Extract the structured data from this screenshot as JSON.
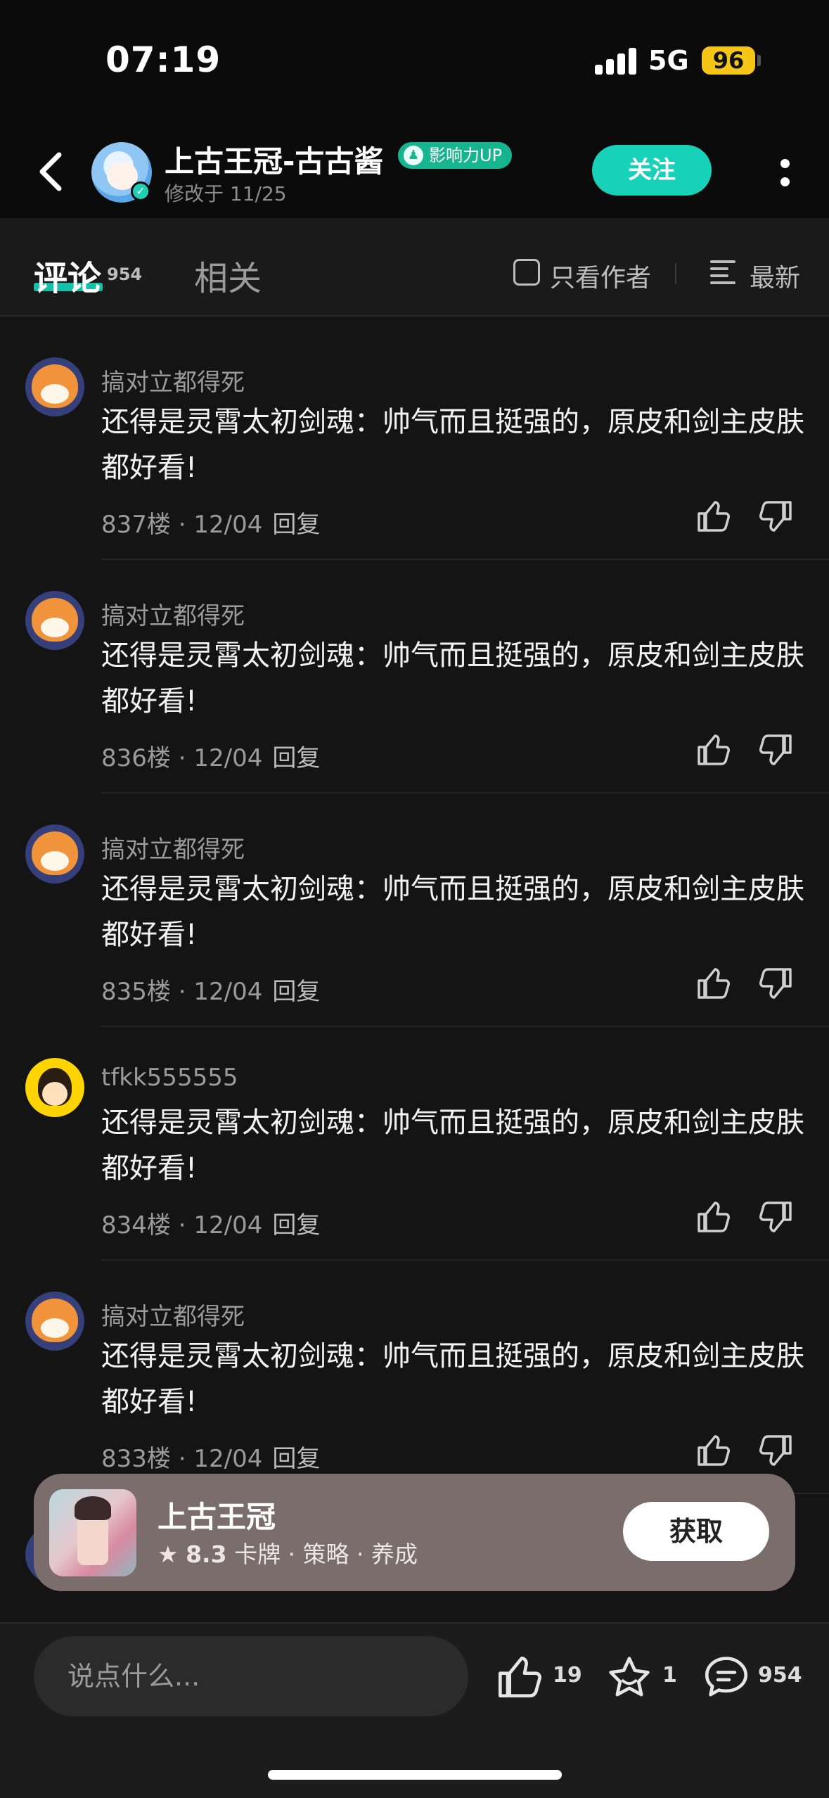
{
  "status_bar": {
    "time": "07:19",
    "network": "5G",
    "battery": "96"
  },
  "header": {
    "title": "上古王冠-古古酱",
    "badge": "影响力UP",
    "subtitle": "修改于 11/25",
    "follow_label": "关注"
  },
  "tabs": {
    "comments_label": "评论",
    "comments_count": "954",
    "related_label": "相关",
    "only_author_label": "只看作者",
    "sort_label": "最新"
  },
  "comments": [
    {
      "user": "搞对立都得死",
      "text": "还得是灵霄太初剑魂：帅气而且挺强的，原皮和剑主皮肤都好看!",
      "floor": "837楼",
      "date": "12/04",
      "reply": "回复"
    },
    {
      "user": "搞对立都得死",
      "text": "还得是灵霄太初剑魂：帅气而且挺强的，原皮和剑主皮肤都好看!",
      "floor": "836楼",
      "date": "12/04",
      "reply": "回复"
    },
    {
      "user": "搞对立都得死",
      "text": "还得是灵霄太初剑魂：帅气而且挺强的，原皮和剑主皮肤都好看!",
      "floor": "835楼",
      "date": "12/04",
      "reply": "回复"
    },
    {
      "user": "tfkk555555",
      "text": "还得是灵霄太初剑魂：帅气而且挺强的，原皮和剑主皮肤都好看!",
      "floor": "834楼",
      "date": "12/04",
      "reply": "回复"
    },
    {
      "user": "搞对立都得死",
      "text": "还得是灵霄太初剑魂：帅气而且挺强的，原皮和剑主皮肤都好看!",
      "floor": "833楼",
      "date": "12/04",
      "reply": "回复"
    }
  ],
  "game_card": {
    "name": "上古王冠",
    "rating": "8.3",
    "tags": "卡牌 · 策略 · 养成",
    "get_label": "获取"
  },
  "bottom_bar": {
    "input_placeholder": "说点什么...",
    "likes": "19",
    "favorites": "1",
    "comments": "954"
  },
  "colors": {
    "accent": "#17d1b9",
    "background": "#141414",
    "card": "#7a6d6c"
  }
}
